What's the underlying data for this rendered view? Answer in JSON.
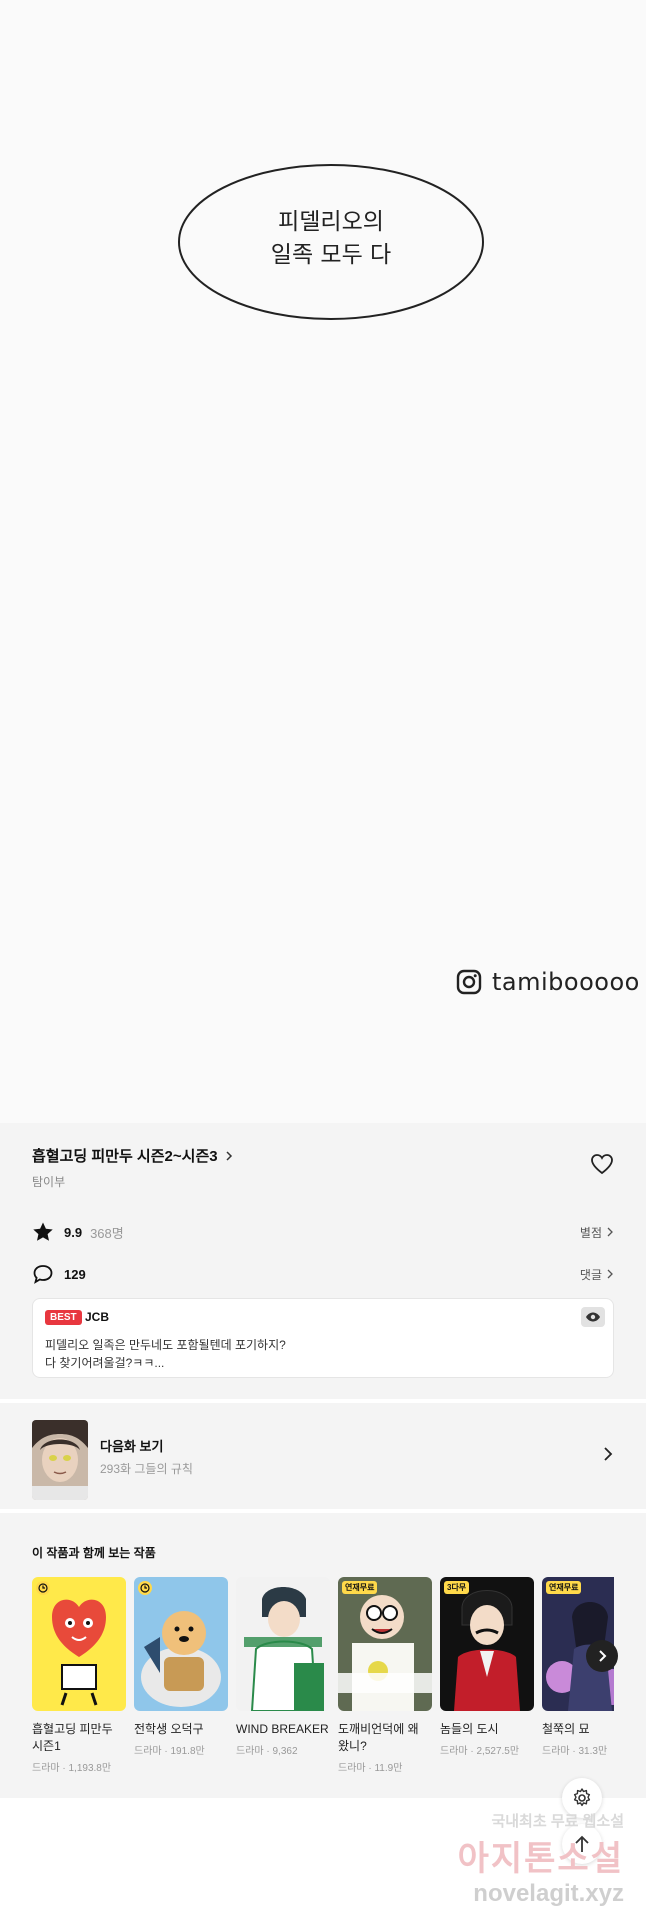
{
  "comic": {
    "bubble_lines": [
      "피델리오의",
      "일족 모두 다"
    ],
    "instagram_handle": "tamibooooo"
  },
  "series": {
    "title": "흡혈고딩 피만두 시즌2~시즌3",
    "author": "탐이부"
  },
  "rating": {
    "score": "9.9",
    "count": "368명",
    "link": "별점"
  },
  "comments": {
    "count": "129",
    "link": "댓글"
  },
  "best_comment": {
    "badge": "BEST",
    "user": "JCB",
    "line1": "피델리오 일족은 만두네도 포함될텐데 포기하지?",
    "line2": "다 찾기어려울걸?ㅋㅋ..."
  },
  "next_episode": {
    "title": "다음화 보기",
    "subtitle": "293화 그들의 규칙"
  },
  "recommendations": {
    "heading": "이 작품과 함께 보는 작품",
    "items": [
      {
        "name": "흡혈고딩 피만두 시즌1",
        "meta": "드라마 · 1,193.8만",
        "badge": ""
      },
      {
        "name": "전학생 오덕구",
        "meta": "드라마 · 191.8만",
        "badge": ""
      },
      {
        "name": "WIND BREAKER",
        "meta": "드라마 · 9,362",
        "badge": ""
      },
      {
        "name": "도깨비언덕에 왜 왔니?",
        "meta": "드라마 · 11.9만",
        "badge": "연재무료"
      },
      {
        "name": "놈들의 도시",
        "meta": "드라마 · 2,527.5만",
        "badge": "3다무"
      },
      {
        "name": "철쭉의 묘",
        "meta": "드라마 · 31.3만",
        "badge": "연재무료"
      }
    ]
  },
  "site_watermark": {
    "line1": "국내최초 무료 웹소설",
    "line2": "아지톤소설",
    "line3": "novelagit.xyz"
  },
  "colors": {
    "best_red": "#e8373f",
    "badge_yellow": "#ffd94a",
    "panel_bg": "#f4f4f4"
  }
}
